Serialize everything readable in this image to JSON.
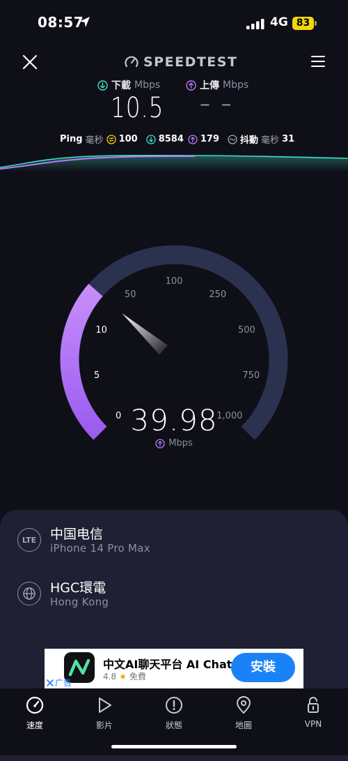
{
  "status_bar": {
    "time": "08:57",
    "network": "4G",
    "battery": "83"
  },
  "header": {
    "logo_text": "SPEEDTEST"
  },
  "metrics": {
    "download_label": "下載",
    "download_unit": "Mbps",
    "download_value": "10.5",
    "upload_label": "上傳",
    "upload_unit": "Mbps",
    "upload_value": "– –"
  },
  "ping": {
    "label": "Ping",
    "unit": "毫秒",
    "idle": "100",
    "down": "8584",
    "up": "179",
    "jitter_label": "抖動",
    "jitter_unit": "毫秒",
    "jitter": "31"
  },
  "gauge": {
    "ticks": [
      "0",
      "5",
      "10",
      "50",
      "100",
      "250",
      "500",
      "750",
      "1,000"
    ],
    "value": "39.98",
    "unit": "Mbps",
    "progress_fraction": 0.32
  },
  "connection": {
    "carrier_icon": "LTE",
    "carrier": "中国电信",
    "device": "iPhone 14 Pro Max",
    "server": "HGC環電",
    "server_location": "Hong Kong"
  },
  "ad": {
    "title": "中文AI聊天平台 AI Chat",
    "rating": "4.8",
    "price": "免費",
    "install": "安裝",
    "badge": "广告"
  },
  "nav": {
    "items": [
      {
        "label": "速度",
        "icon": "speedometer-icon"
      },
      {
        "label": "影片",
        "icon": "play-icon"
      },
      {
        "label": "狀態",
        "icon": "alert-icon"
      },
      {
        "label": "地圖",
        "icon": "map-pin-icon"
      },
      {
        "label": "VPN",
        "icon": "lock-icon"
      }
    ]
  },
  "colors": {
    "accent_download": "#3ee0c8",
    "accent_upload": "#b77cf6",
    "gauge_track": "#2b3250",
    "background": "#0f0f17"
  }
}
